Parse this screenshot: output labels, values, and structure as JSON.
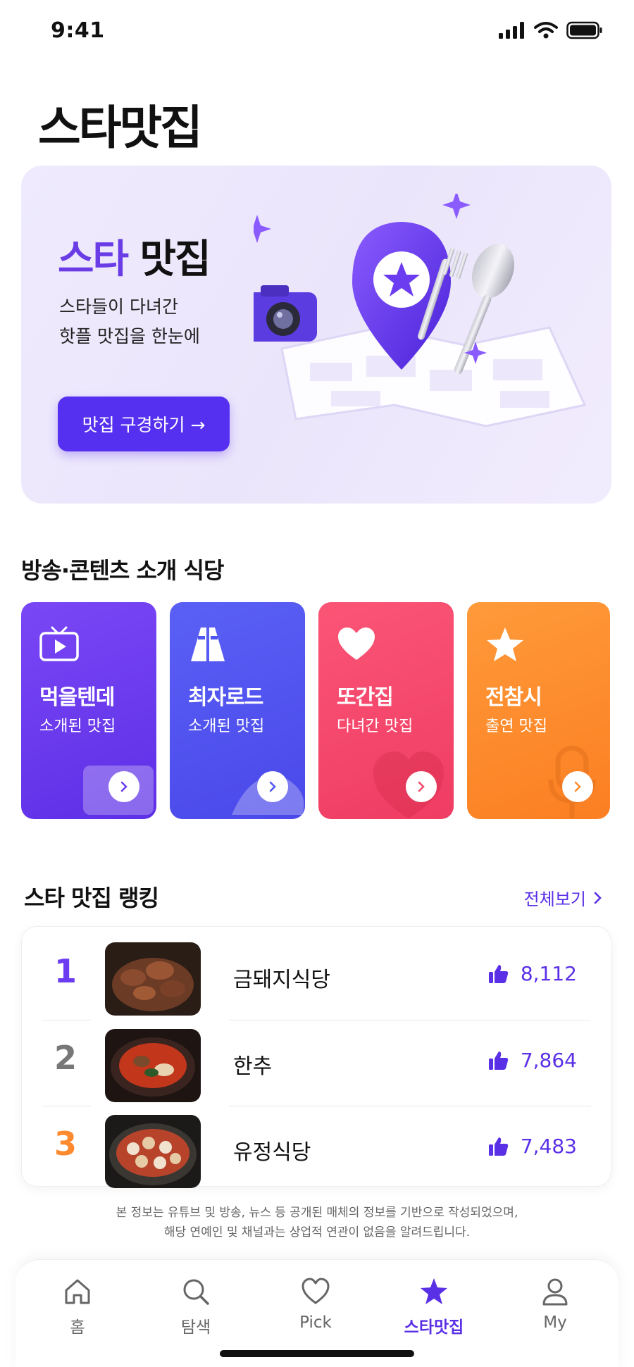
{
  "status_bar": {
    "time": "9:41"
  },
  "page_title": "스타맛집",
  "hero": {
    "title_accent": "스타",
    "title_rest": " 맛집",
    "desc_line1": "스타들이 다녀간",
    "desc_line2": "핫플 맛집을 한눈에",
    "button_label": "맛집 구경하기 →",
    "accent_color": "#5530f0"
  },
  "broadcast_section": {
    "title": "방송·콘텐츠 소개 식당",
    "cards": [
      {
        "name": "먹을텐데",
        "sub": "소개된 맛집",
        "icon": "tv-icon",
        "color": "#6b3cf0"
      },
      {
        "name": "최자로드",
        "sub": "소개된 맛집",
        "icon": "road-icon",
        "color": "#4f55f2"
      },
      {
        "name": "또간집",
        "sub": "다녀간 맛집",
        "icon": "heart-icon",
        "color": "#f4486a"
      },
      {
        "name": "전참시",
        "sub": "출연 맛집",
        "icon": "star-icon",
        "color": "#fd8a2e"
      }
    ]
  },
  "ranking": {
    "title": "스타 맛집 랭킹",
    "see_all": "전체보기",
    "items": [
      {
        "rank": "1",
        "name": "금돼지식당",
        "likes": "8,112",
        "rank_color": "#6b3cf0"
      },
      {
        "rank": "2",
        "name": "한추",
        "likes": "7,864",
        "rank_color": "#777777"
      },
      {
        "rank": "3",
        "name": "유정식당",
        "likes": "7,483",
        "rank_color": "#fd8a2e"
      }
    ]
  },
  "disclaimer": {
    "line1": "본 정보는 유튜브 및 방송, 뉴스 등 공개된 매체의 정보를 기반으로 작성되었으며,",
    "line2": "해당 연예인 및 채널과는 상업적 연관이 없음을 알려드립니다."
  },
  "bottom_nav": [
    {
      "label": "홈",
      "icon": "home-icon",
      "active": false
    },
    {
      "label": "탐색",
      "icon": "search-icon",
      "active": false
    },
    {
      "label": "Pick",
      "icon": "heart-icon",
      "active": false
    },
    {
      "label": "스타맛집",
      "icon": "star-icon",
      "active": true
    },
    {
      "label": "My",
      "icon": "user-icon",
      "active": false
    }
  ]
}
